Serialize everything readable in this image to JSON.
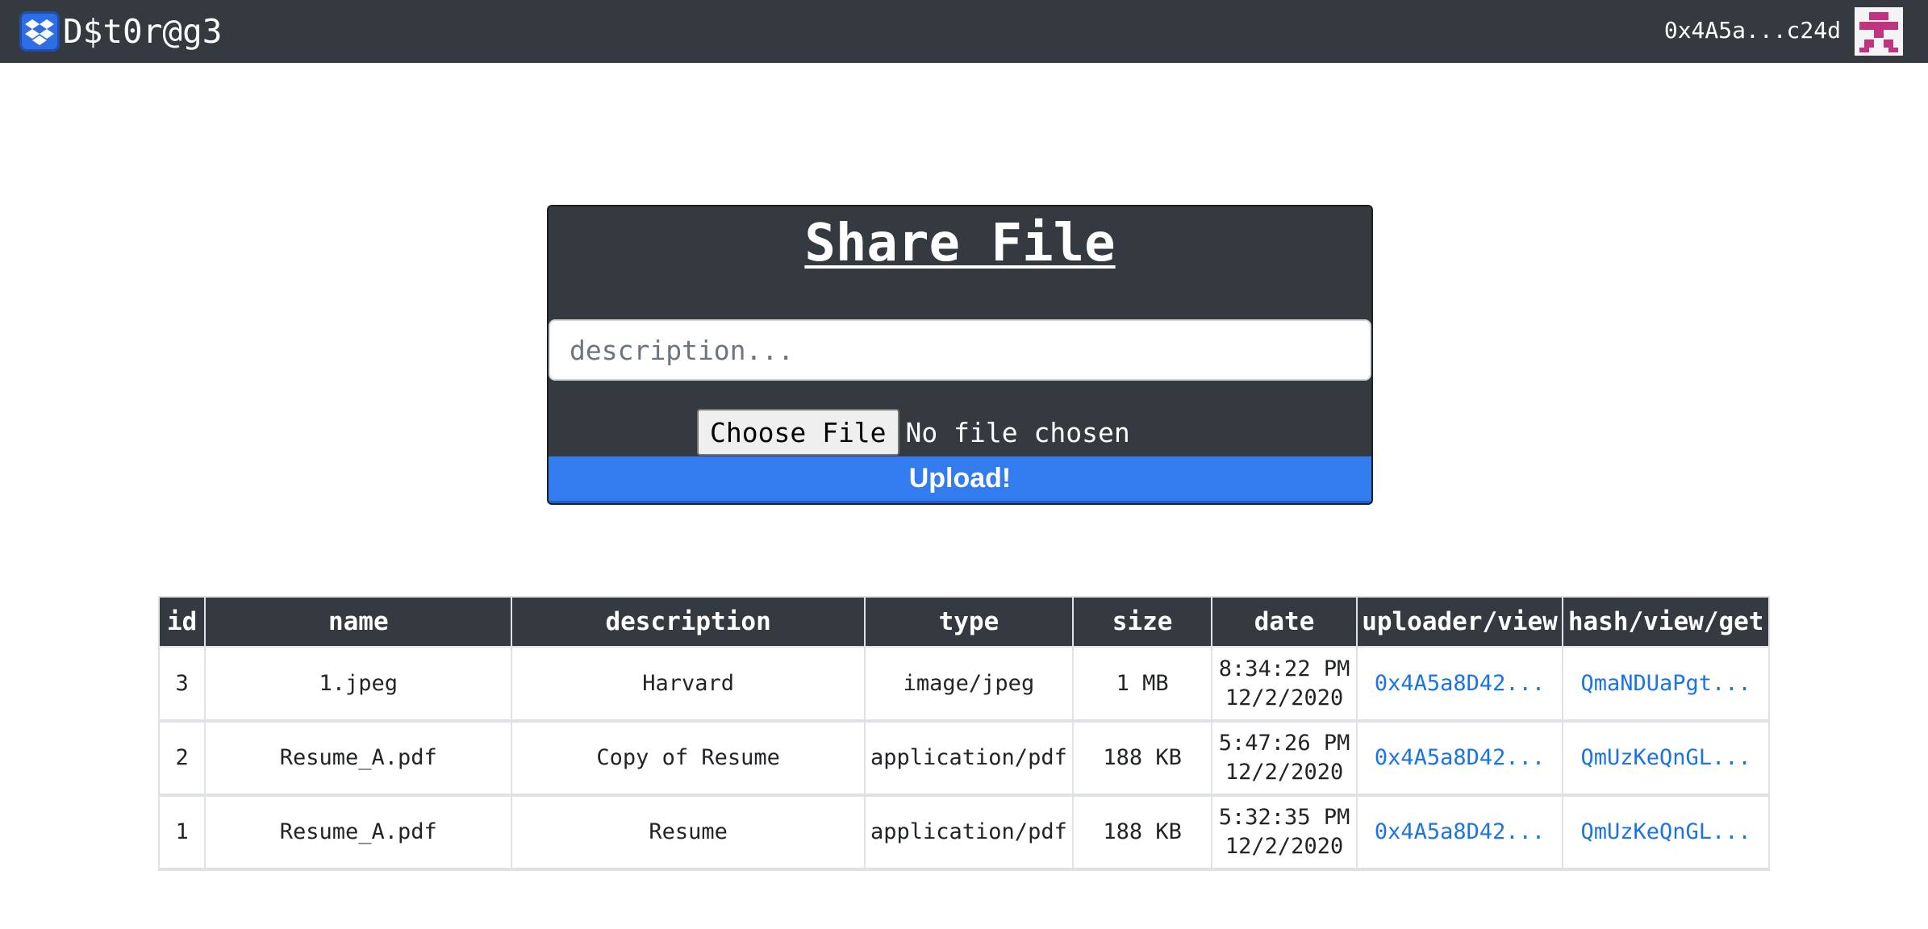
{
  "navbar": {
    "brand": "D$t0r@g3",
    "logo_icon": "dropbox-icon",
    "account": "0x4A5a...c24d",
    "avatar_icon": "identicon-avatar",
    "background": "#343a40"
  },
  "share": {
    "title": "Share File",
    "description_placeholder": "description...",
    "choose_file_label": "Choose File",
    "no_file_text": "No file chosen",
    "upload_label": "Upload!",
    "accent": "#337cf0"
  },
  "table": {
    "columns": [
      "id",
      "name",
      "description",
      "type",
      "size",
      "date",
      "uploader/view",
      "hash/view/get"
    ],
    "rows": [
      {
        "id": "3",
        "name": "1.jpeg",
        "description": "Harvard",
        "type": "image/jpeg",
        "size": "1 MB",
        "time": "8:34:22 PM",
        "date": "12/2/2020",
        "uploader": "0x4A5a8D42...",
        "hash": "QmaNDUaPgt..."
      },
      {
        "id": "2",
        "name": "Resume_A.pdf",
        "description": "Copy of Resume",
        "type": "application/pdf",
        "size": "188 KB",
        "time": "5:47:26 PM",
        "date": "12/2/2020",
        "uploader": "0x4A5a8D42...",
        "hash": "QmUzKeQnGL..."
      },
      {
        "id": "1",
        "name": "Resume_A.pdf",
        "description": "Resume",
        "type": "application/pdf",
        "size": "188 KB",
        "time": "5:32:35 PM",
        "date": "12/2/2020",
        "uploader": "0x4A5a8D42...",
        "hash": "QmUzKeQnGL..."
      }
    ]
  }
}
